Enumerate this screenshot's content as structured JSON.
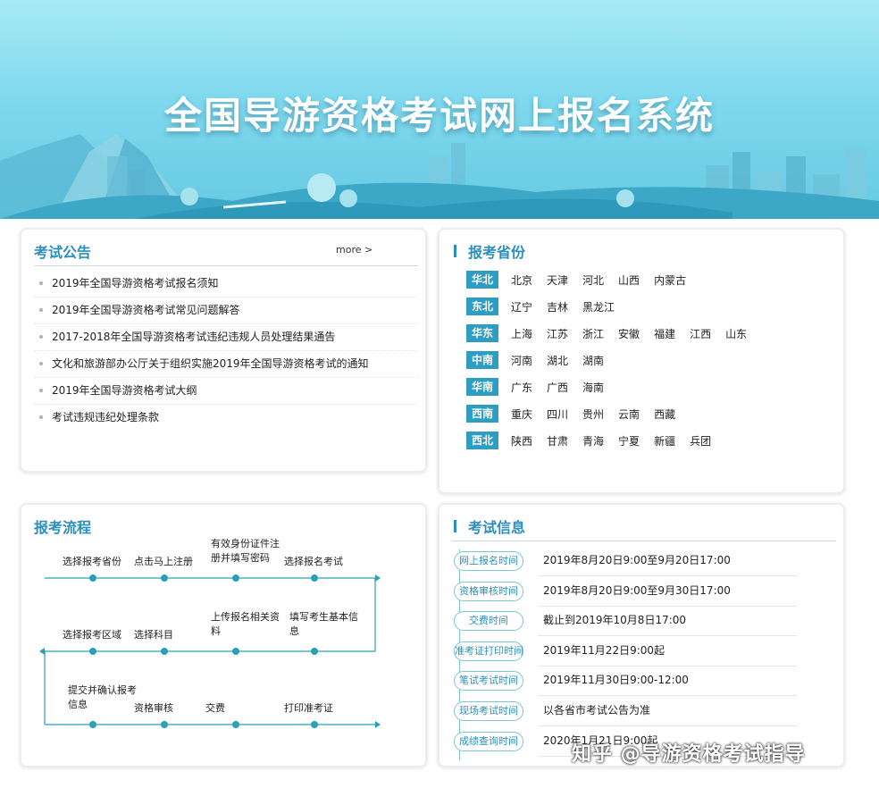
{
  "header": {
    "title": "全国导游资格考试网上报名系统"
  },
  "notices": {
    "title": "考试公告",
    "more_label": "more >",
    "items": [
      "2019年全国导游资格考试报名须知",
      "2019年全国导游资格考试常见问题解答",
      "2017-2018年全国导游资格考试违纪违规人员处理结果通告",
      "文化和旅游部办公厅关于组织实施2019年全国导游资格考试的通知",
      "2019年全国导游资格考试大纲",
      "考试违规违纪处理条款"
    ]
  },
  "provinces": {
    "title": "报考省份",
    "regions": [
      {
        "name": "华北",
        "items": [
          "北京",
          "天津",
          "河北",
          "山西",
          "内蒙古"
        ]
      },
      {
        "name": "东北",
        "items": [
          "辽宁",
          "吉林",
          "黑龙江"
        ]
      },
      {
        "name": "华东",
        "items": [
          "上海",
          "江苏",
          "浙江",
          "安徽",
          "福建",
          "江西",
          "山东"
        ]
      },
      {
        "name": "中南",
        "items": [
          "河南",
          "湖北",
          "湖南"
        ]
      },
      {
        "name": "华南",
        "items": [
          "广东",
          "广西",
          "海南"
        ]
      },
      {
        "name": "西南",
        "items": [
          "重庆",
          "四川",
          "贵州",
          "云南",
          "西藏"
        ]
      },
      {
        "name": "西北",
        "items": [
          "陕西",
          "甘肃",
          "青海",
          "宁夏",
          "新疆",
          "兵团"
        ]
      }
    ]
  },
  "flow": {
    "title": "报考流程",
    "row1": [
      "选择报考省份",
      "点击马上注册",
      "有效身份证件注册并填写密码",
      "选择报名考试"
    ],
    "row2": [
      "选择报考区域",
      "选择科目",
      "上传报名相关资料",
      "填写考生基本信息"
    ],
    "row3": [
      "提交并确认报考信息",
      "资格审核",
      "交费",
      "打印准考证"
    ]
  },
  "exam_info": {
    "title": "考试信息",
    "rows": [
      {
        "label": "网上报名时间",
        "value": "2019年8月20日9:00至9月20日17:00"
      },
      {
        "label": "资格审核时间",
        "value": "2019年8月20日9:00至9月30日17:00"
      },
      {
        "label": "交费时间",
        "value": "截止到2019年10月8日17:00"
      },
      {
        "label": "准考证打印时间",
        "value": "2019年11月22日9:00起"
      },
      {
        "label": "笔试考试时间",
        "value": "2019年11月30日9:00-12:00"
      },
      {
        "label": "现场考试时间",
        "value": "以各省市考试公告为准"
      },
      {
        "label": "成绩查询时间",
        "value": "2020年1月21日9:00起"
      }
    ]
  },
  "watermark": "知乎 @导游资格考试指导",
  "colors": {
    "accent": "#2a8fbd",
    "region_tag": "#2d9dc4",
    "flow_line": "#2a9fb5"
  }
}
